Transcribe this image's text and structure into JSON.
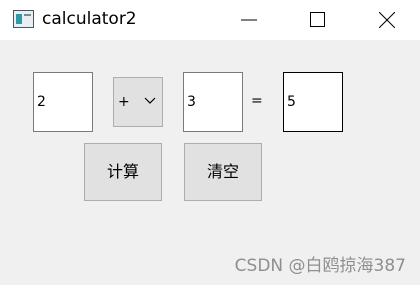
{
  "window": {
    "title": "calculator2",
    "icon": "app-window-icon"
  },
  "titlebar_buttons": {
    "minimize": "minimize-icon",
    "maximize": "maximize-icon",
    "close": "close-icon"
  },
  "form": {
    "operand1": "2",
    "operator": "+",
    "operand2": "3",
    "equals": "=",
    "result": "5"
  },
  "buttons": {
    "calculate": "计算",
    "clear": "清空"
  },
  "watermark": "CSDN @白鸥掠海387"
}
